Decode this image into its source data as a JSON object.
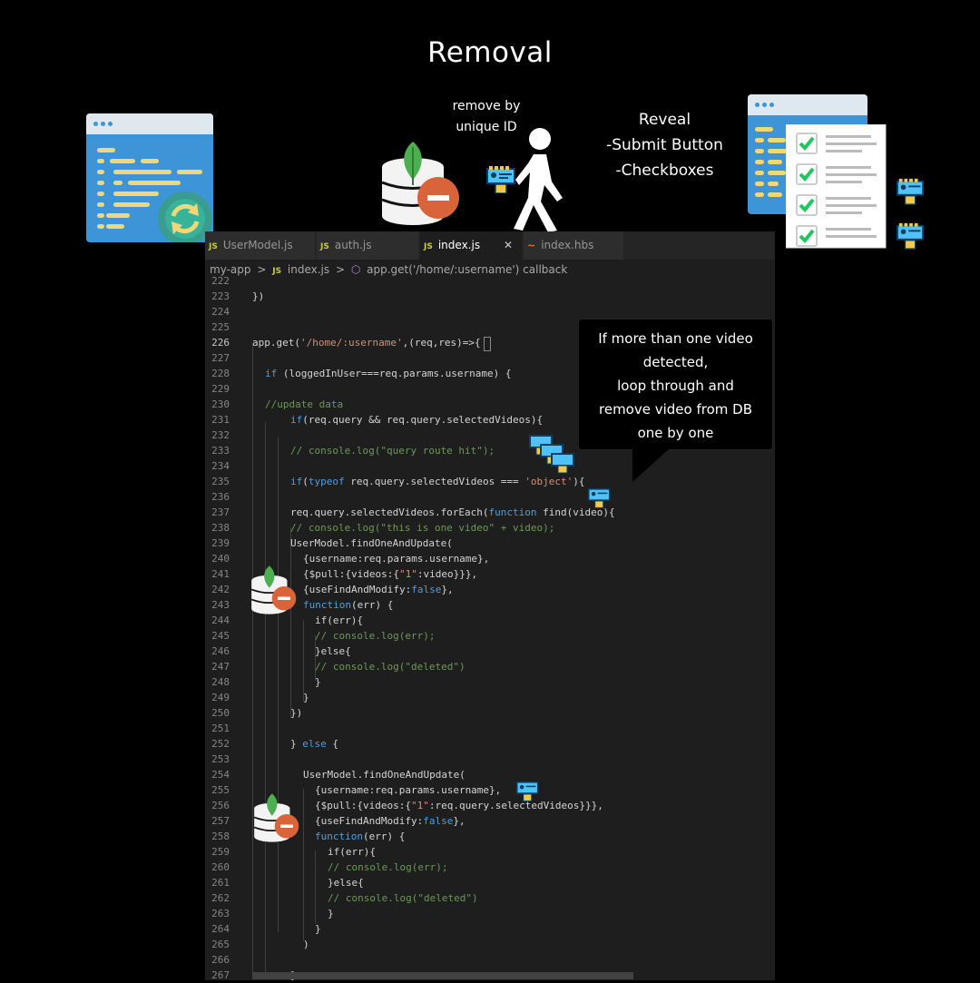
{
  "header": {
    "title": "Removal",
    "remove_caption": [
      "remove by",
      "unique ID"
    ],
    "reveal_caption": [
      "Reveal",
      "-Submit Button",
      "-Checkboxes"
    ]
  },
  "editor": {
    "tabs": [
      {
        "label": "UserModel.js",
        "type": "JS"
      },
      {
        "label": "auth.js",
        "type": "JS"
      },
      {
        "label": "index.js",
        "type": "JS",
        "active": true
      },
      {
        "label": "index.hbs",
        "type": "hbs"
      }
    ],
    "breadcrumb": [
      "my-app",
      ">",
      "index.js",
      ">",
      "app.get('/home/:username') callback"
    ],
    "current_line": "226",
    "line_numbers": [
      "222",
      "223",
      "224",
      "225",
      "226",
      "227",
      "228",
      "229",
      "230",
      "231",
      "232",
      "233",
      "234",
      "235",
      "236",
      "237",
      "238",
      "239",
      "240",
      "241",
      "242",
      "243",
      "244",
      "245",
      "246",
      "247",
      "248",
      "249",
      "250",
      "251",
      "252",
      "253",
      "254",
      "255",
      "256",
      "257",
      "258",
      "259",
      "260",
      "261",
      "262",
      "263",
      "264",
      "265",
      "266",
      "267"
    ],
    "code": {
      "l223": "})",
      "l226a": "app.get(",
      "l226b": "'/home/:username'",
      "l226c": ",(req,res)=>{",
      "l228a": "if",
      "l228b": " (loggedInUser===req.params.username) {",
      "l230": "//update data",
      "l231a": "if",
      "l231b": "(req.query && req.query.selectedVideos){",
      "l233": "// console.log(\"query route hit\");",
      "l235a": "if",
      "l235b": "(",
      "l235c": "typeof",
      "l235d": " req.query.selectedVideos === ",
      "l235e": "'object'",
      "l235f": "){",
      "l237a": "req.query.selectedVideos.forEach(",
      "l237b": "function",
      "l237c": " find(video){",
      "l238": "// console.log(\"this is one video\" + video);",
      "l239": "UserModel.findOneAndUpdate(",
      "l240": "{username:req.params.username},",
      "l241a": "{$pull:{videos:{",
      "l241b": "\"1\"",
      "l241c": ":video}}},",
      "l242a": "{useFindAndModify:",
      "l242b": "false",
      "l242c": "},",
      "l243a": "function",
      "l243b": "(err) {",
      "l244": "if(err){",
      "l245": "// console.log(err);",
      "l246": "}else{",
      "l247": "// console.log(\"deleted\")",
      "l248": "}",
      "l249": "}",
      "l250": "})",
      "l252a": "} ",
      "l252b": "else",
      "l252c": " {",
      "l254": "UserModel.findOneAndUpdate(",
      "l255": "{username:req.params.username},",
      "l256a": "{$pull:{videos:{",
      "l256b": "\"1\"",
      "l256c": ":req.query.selectedVideos}}},",
      "l257a": "{useFindAndModify:",
      "l257b": "false",
      "l257c": "},",
      "l258a": "function",
      "l258b": "(err) {",
      "l259": "if(err){",
      "l260": "// console.log(err);",
      "l261": "}else{",
      "l262": "// console.log(\"deleted\")",
      "l263": "}",
      "l264": "}",
      "l265": ")",
      "l267": "}"
    }
  },
  "callout": {
    "lines": [
      "If more than one video",
      "detected,",
      "loop through and",
      "remove video from DB",
      "one by one"
    ]
  },
  "colors": {
    "accent_orange": "#d9643a",
    "mongo_green": "#4caf50",
    "check_green": "#22c55e",
    "browser_blue": "#3d94d6"
  },
  "icons": [
    "browser-refresh-icon",
    "database-remove-icon",
    "walking-person-icon",
    "video-card-icon",
    "checklist-browser-icon"
  ]
}
